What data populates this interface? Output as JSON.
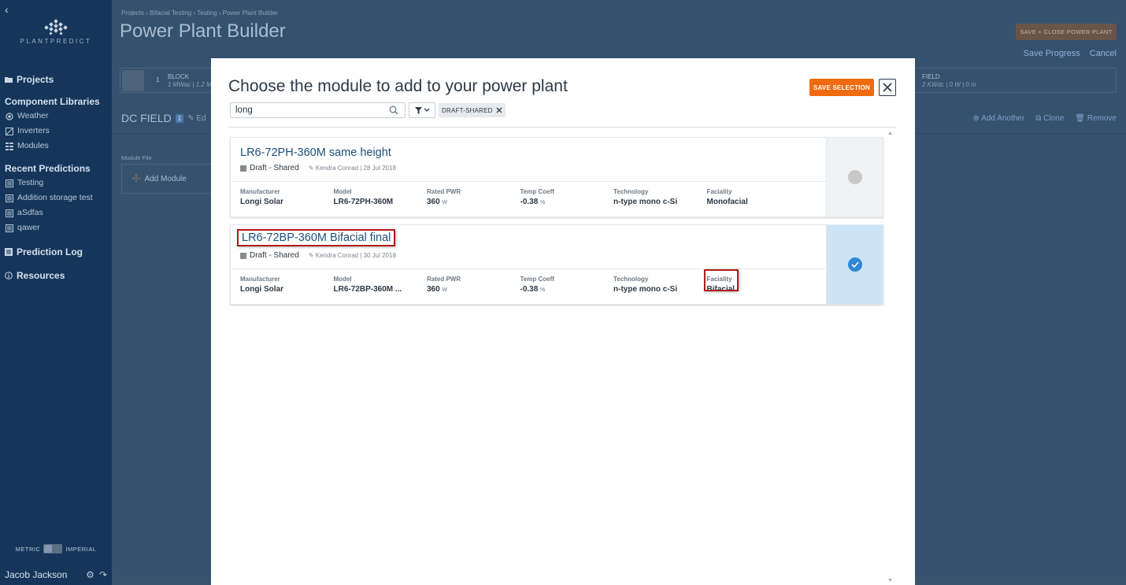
{
  "app": {
    "logo_text": "PLANTPREDICT",
    "back_icon": "chevron-left-icon"
  },
  "sidebar": {
    "projects": "Projects",
    "component_libraries": "Component Libraries",
    "libraries": [
      {
        "label": "Weather",
        "icon": "weather-icon"
      },
      {
        "label": "Inverters",
        "icon": "inverter-icon"
      },
      {
        "label": "Modules",
        "icon": "module-icon"
      }
    ],
    "recent_predictions": "Recent Predictions",
    "recent": [
      {
        "label": "Testing"
      },
      {
        "label": "Addition storage test"
      },
      {
        "label": "aSdfas"
      },
      {
        "label": "qawer"
      }
    ],
    "prediction_log": "Prediction Log",
    "resources": "Resources",
    "units_metric": "METRIC",
    "units_imperial": "IMPERIAL",
    "user_name": "Jacob Jackson"
  },
  "page": {
    "breadcrumb": [
      "Projects",
      "Bifacial Testing",
      "Testing",
      "Power Plant Builder"
    ],
    "title": "Power Plant Builder",
    "save_close": "SAVE + CLOSE POWER PLANT",
    "save_progress": "Save Progress",
    "cancel": "Cancel",
    "block": {
      "number": "1",
      "label": "BLOCK",
      "sub": "1 MWac | 1.2 M"
    },
    "field": {
      "label": "FIELD",
      "sub": "2 KWdc | 0 W | 0 m"
    },
    "dc_field": "DC FIELD",
    "dc_badge": "1",
    "dc_edit": "Ed",
    "add_another": "Add Another",
    "clone": "Clone",
    "remove": "Remove",
    "module_file": "Module File",
    "add_module": "Add Module"
  },
  "modal": {
    "title": "Choose the module to add to your power plant",
    "save_selection": "SAVE SELECTION",
    "search_value": "long",
    "filter_chip": "DRAFT-SHARED",
    "columns": [
      "Manufacturer",
      "Model",
      "Rated PWR",
      "Temp Coeff",
      "Technology",
      "Faciality"
    ],
    "modules": [
      {
        "name": "LR6-72PH-360M same height",
        "status": "Draft - Shared",
        "meta": "Kendra Conrad | 28 Jul 2018",
        "manufacturer": "Longi Solar",
        "model": "LR6-72PH-360M",
        "rated_pwr": "360",
        "rated_unit": "W",
        "temp_coeff": "-0.38",
        "temp_unit": "%",
        "technology": "n-type mono c-Si",
        "faciality": "Monofacial",
        "selected": false
      },
      {
        "name": "LR6-72BP-360M Bifacial final",
        "status": "Draft - Shared",
        "meta": "Kendra Conrad | 30 Jul 2018",
        "manufacturer": "Longi Solar",
        "model": "LR6-72BP-360M ...",
        "rated_pwr": "360",
        "rated_unit": "W",
        "temp_coeff": "-0.38",
        "temp_unit": "%",
        "technology": "n-type mono c-Si",
        "faciality": "Bifacial",
        "selected": true
      }
    ]
  },
  "colors": {
    "accent": "#f06a0f",
    "selected_bg": "#cde4f6",
    "check": "#2f86d6",
    "highlight": "#b01c1c"
  }
}
